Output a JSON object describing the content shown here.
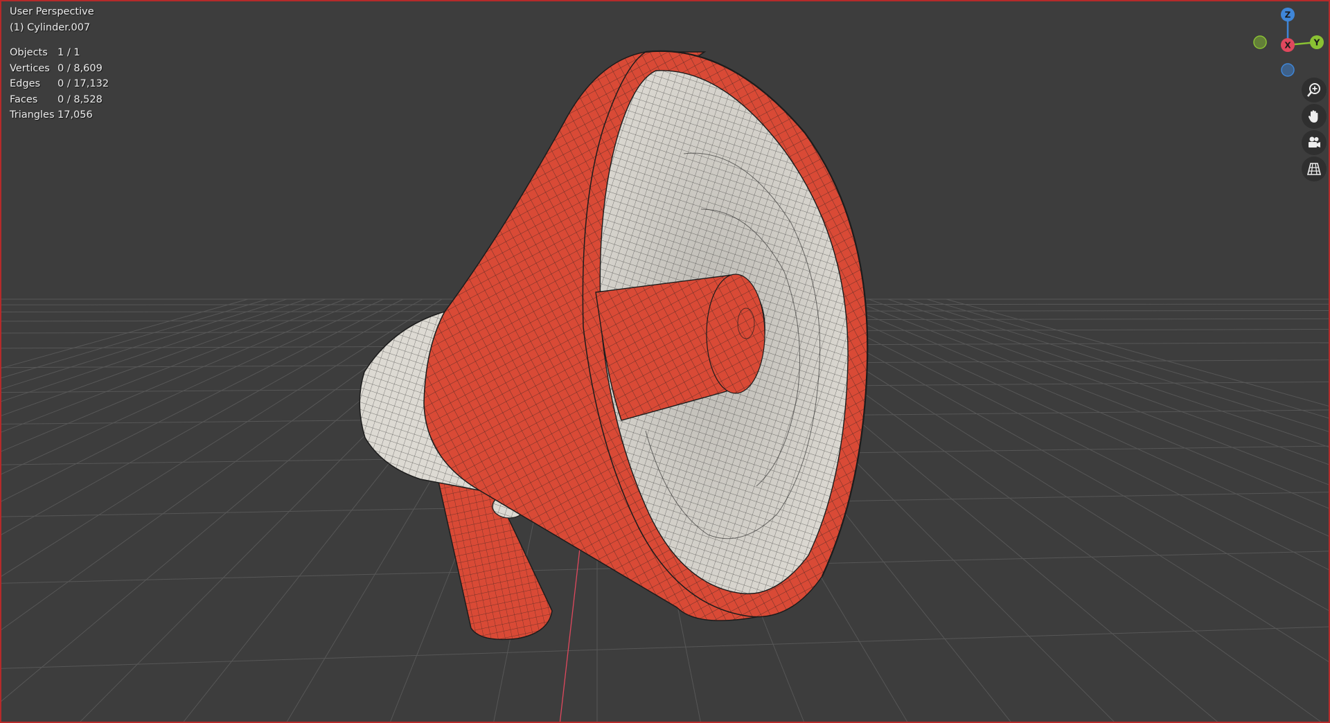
{
  "viewport": {
    "view_name": "User Perspective",
    "object_name": "(1) Cylinder.007"
  },
  "stats": [
    {
      "label": "Objects",
      "value": "1 / 1"
    },
    {
      "label": "Vertices",
      "value": "0 / 8,609"
    },
    {
      "label": "Edges",
      "value": "0 / 17,132"
    },
    {
      "label": "Faces",
      "value": "0 / 8,528"
    },
    {
      "label": "Triangles",
      "value": "17,056"
    }
  ],
  "gizmo": {
    "z": "Z",
    "y": "Y",
    "x": "X"
  },
  "navigation_icons": [
    "zoom-icon",
    "pan-hand-icon",
    "camera-icon",
    "perspective-grid-icon"
  ],
  "colors": {
    "background": "#3d3d3d",
    "grid": "#575757",
    "x_axis": "#e0485d",
    "y_axis": "#8ac233",
    "z_axis": "#3f86d8",
    "model_red": "#d94a36",
    "model_white": "#dddad3",
    "wire": "#1c1c1c",
    "viewport_border": "#b52a2a"
  }
}
